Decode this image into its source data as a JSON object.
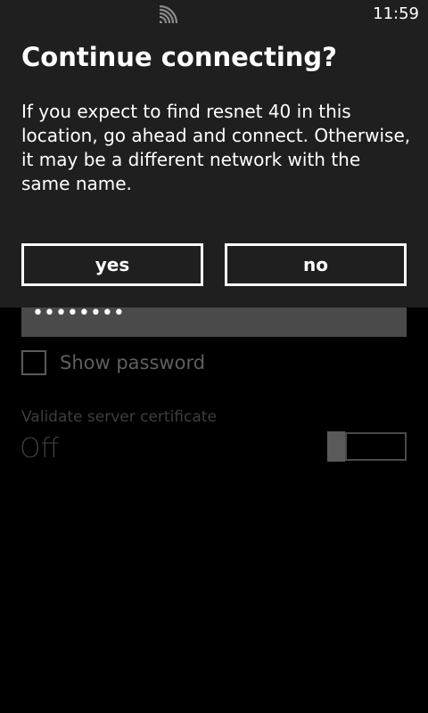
{
  "status_bar": {
    "time": "11:59",
    "signal_icon": "wifi-signal-icon"
  },
  "dialog": {
    "title": "Continue connecting?",
    "body": "If you expect to find resnet 40 in this location, go ahead and connect. Otherwise, it may be a different network with the same name.",
    "yes_label": "yes",
    "no_label": "no"
  },
  "form": {
    "password_value": "••••••••",
    "show_password_label": "Show password",
    "show_password_checked": false,
    "validate_cert_label": "Validate server certificate",
    "validate_cert_value": "Off",
    "validate_cert_on": false
  },
  "colors": {
    "dialog_background": "#1f1f1f",
    "page_background": "#000000",
    "text_primary": "#ffffff",
    "text_dimmed": "#5f5f5f"
  }
}
